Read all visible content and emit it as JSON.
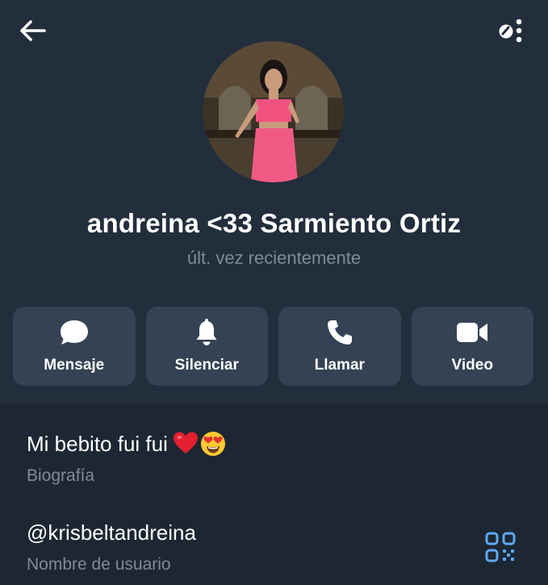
{
  "profile": {
    "name": "andreina <33 Sarmiento Ortiz",
    "status": "últ. vez recientemente"
  },
  "actions": [
    {
      "label": "Mensaje",
      "icon": "message-bubble-icon"
    },
    {
      "label": "Silenciar",
      "icon": "bell-icon"
    },
    {
      "label": "Llamar",
      "icon": "phone-icon"
    },
    {
      "label": "Video",
      "icon": "video-camera-icon"
    }
  ],
  "info": {
    "bio": "Mi bebito fui fui",
    "bio_emojis": [
      "red-heart",
      "heart-eyes-face"
    ],
    "bio_label": "Biografía",
    "username": "@krisbeltandreina",
    "username_label": "Nombre de usuario"
  },
  "icons": {
    "back": "back-arrow-icon",
    "more": "more-options-icon",
    "qr": "qr-code-icon"
  },
  "colors": {
    "header_bg": "#232e3c",
    "info_bg": "#1d2733",
    "button_bg": "#344254",
    "secondary_text": "#7f8b99",
    "accent": "#5eaaf2"
  }
}
